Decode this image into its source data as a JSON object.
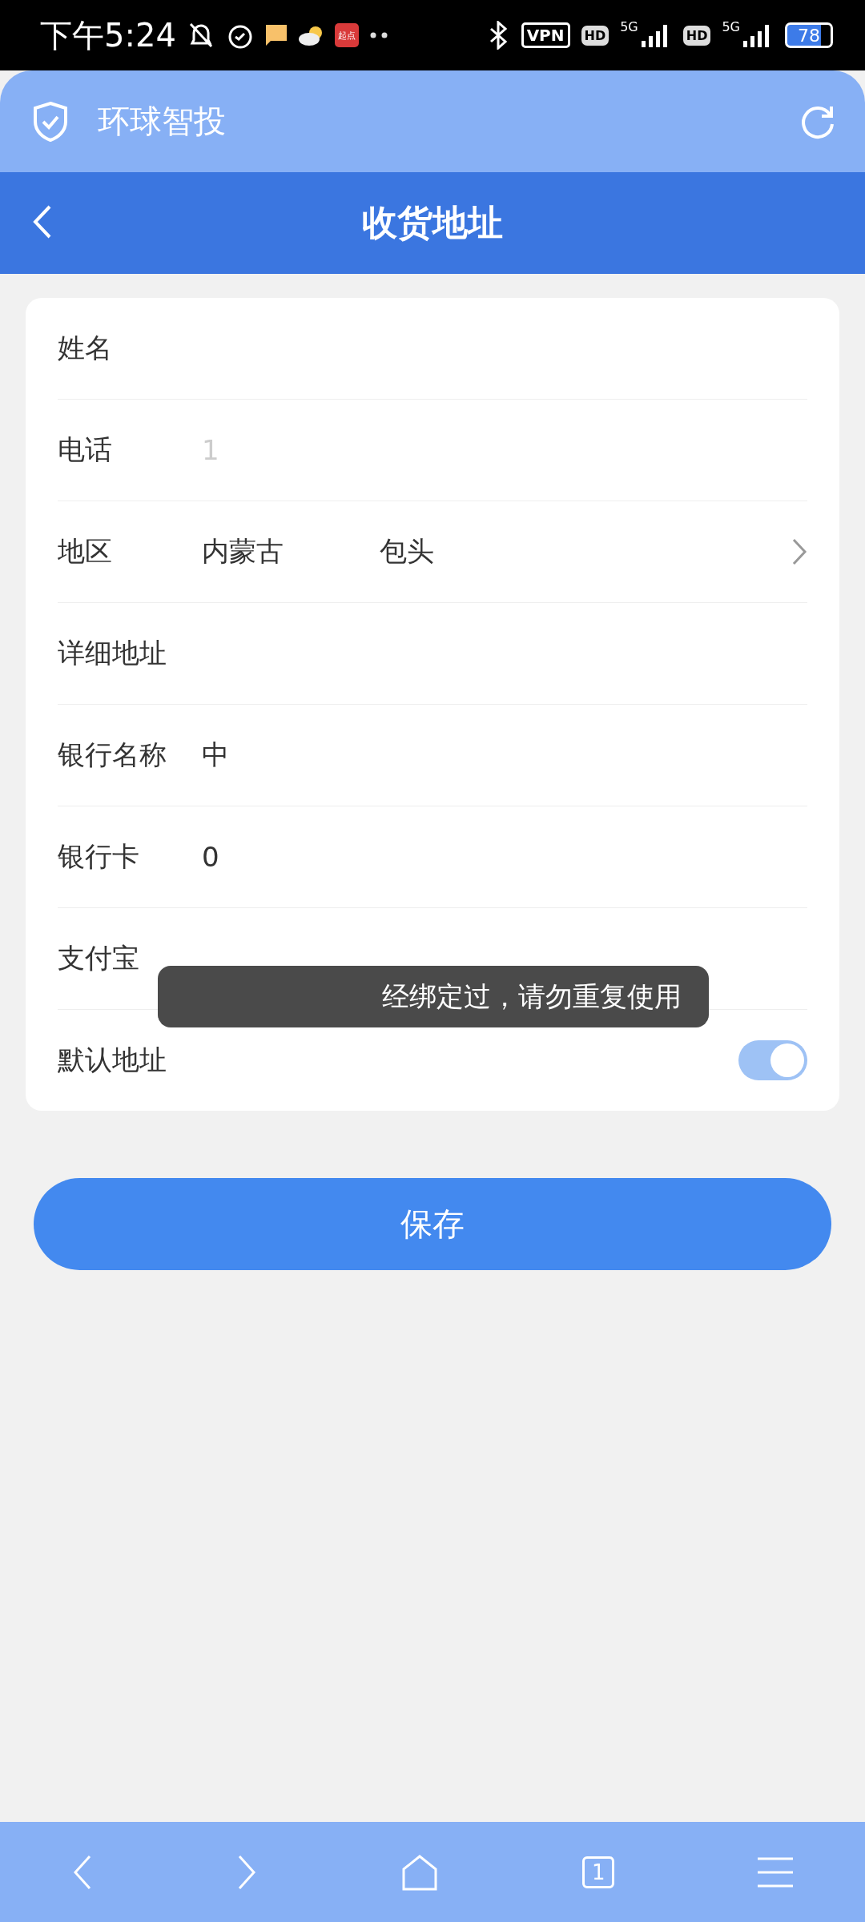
{
  "status_bar": {
    "time": "下午5:24",
    "app_badge": "起点",
    "vpn": "VPN",
    "hd_1": "HD",
    "net_1": "5G",
    "hd_2": "HD",
    "net_2": "5G",
    "battery": "78"
  },
  "app_bar": {
    "title": "环球智投"
  },
  "nav_bar": {
    "title": "收货地址"
  },
  "form": {
    "rows": [
      {
        "kind": "text",
        "label": "姓名"
      },
      {
        "kind": "text",
        "label": "电话",
        "value": "1",
        "faded": true
      },
      {
        "kind": "select",
        "label": "地区",
        "value": "内蒙古",
        "value_2": "包头"
      },
      {
        "kind": "text",
        "label": "详细地址"
      },
      {
        "kind": "text",
        "label": "银行名称",
        "value": "中"
      },
      {
        "kind": "text",
        "label": "银行卡",
        "value": "0"
      },
      {
        "kind": "text",
        "label": "支付宝"
      },
      {
        "kind": "switch",
        "label": "默认地址",
        "on": true
      }
    ]
  },
  "toast": {
    "text": "经绑定过，请勿重复使用"
  },
  "save_button": {
    "label": "保存"
  },
  "browser_bar": {
    "tab_count": "1"
  }
}
